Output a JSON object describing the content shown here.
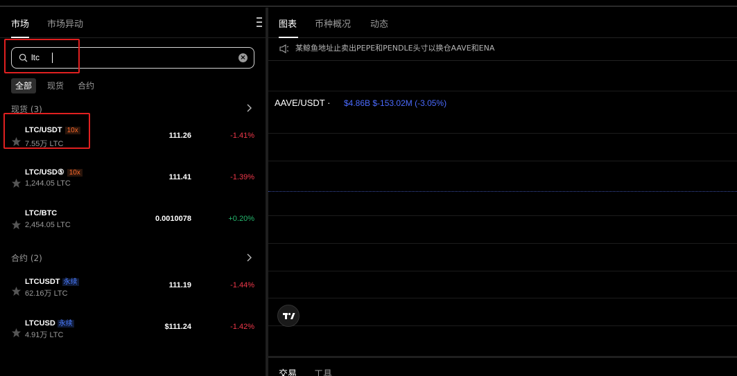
{
  "market_panel": {
    "tabs": [
      {
        "label": "市场",
        "active": true
      },
      {
        "label": "市场异动",
        "active": false
      }
    ],
    "more_icon": "vertical-bars-icon",
    "search": {
      "value": "ltc",
      "icon": "search-icon",
      "clear_icon": "clear-icon"
    },
    "filters": [
      {
        "label": "全部",
        "active": true
      },
      {
        "label": "现货",
        "active": false
      },
      {
        "label": "合约",
        "active": false
      }
    ],
    "spot_section": {
      "title": "现货 (3)",
      "rows": [
        {
          "symbol": "LTC/USDT",
          "tag": "10x",
          "volume": "7.55万 LTC",
          "price": "111.26",
          "change": "-1.41%",
          "direction": "down"
        },
        {
          "symbol": "LTC/USD⑤",
          "tag": "10x",
          "volume": "1,244.05 LTC",
          "price": "111.41",
          "change": "-1.39%",
          "direction": "down"
        },
        {
          "symbol": "LTC/BTC",
          "tag": "",
          "volume": "2,454.05 LTC",
          "price": "0.0010078",
          "change": "+0.20%",
          "direction": "up"
        }
      ]
    },
    "futures_section": {
      "title": "合约 (2)",
      "rows": [
        {
          "symbol": "LTCUSDT",
          "tag": "永续",
          "volume": "62.16万 LTC",
          "price": "111.19",
          "change": "-1.44%",
          "direction": "down"
        },
        {
          "symbol": "LTCUSD",
          "tag": "永续",
          "volume": "4.91万 LTC",
          "price": "$111.24",
          "change": "-1.42%",
          "direction": "down"
        }
      ]
    }
  },
  "chart_panel": {
    "tabs": [
      {
        "label": "图表",
        "active": true
      },
      {
        "label": "币种概况",
        "active": false
      },
      {
        "label": "动态",
        "active": false
      }
    ],
    "news": {
      "icon": "speaker-icon",
      "text": "某鲸鱼地址止卖出PEPE和PENDLE头寸以换仓AAVE和ENA"
    },
    "pair_title": "AAVE/USDT ·",
    "pair_stats": "$4.86B  $-153.02M (-3.05%)",
    "tv_logo": "tradingview-logo-icon",
    "bottom_tabs": [
      {
        "label": "交易",
        "active": true
      },
      {
        "label": "工具",
        "active": false
      }
    ]
  },
  "colors": {
    "background": "#000000",
    "negative": "#f0384a",
    "positive": "#25b86e",
    "accent_blue": "#4b6bff",
    "leverage_tag": "#ff6a2b",
    "highlight_box": "#e02020"
  }
}
